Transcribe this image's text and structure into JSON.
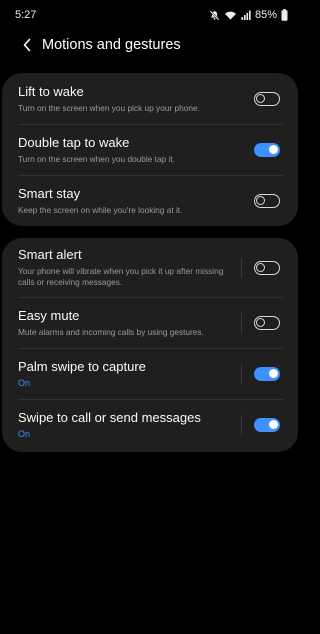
{
  "status_bar": {
    "time": "5:27",
    "battery": "85%"
  },
  "header": {
    "title": "Motions and gestures"
  },
  "group1": [
    {
      "title": "Lift to wake",
      "subtitle": "Turn on the screen when you pick up your phone.",
      "enabled": false
    },
    {
      "title": "Double tap to wake",
      "subtitle": "Turn on the screen when you double tap it.",
      "enabled": true
    },
    {
      "title": "Smart stay",
      "subtitle": "Keep the screen on while you're looking at it.",
      "enabled": false
    }
  ],
  "group2": [
    {
      "title": "Smart alert",
      "subtitle": "Your phone will vibrate when you pick it up after missing calls or receiving messages.",
      "enabled": false
    },
    {
      "title": "Easy mute",
      "subtitle": "Mute alarms and incoming calls by using gestures.",
      "enabled": false
    },
    {
      "title": "Palm swipe to capture",
      "subtitle": "On",
      "enabled": true
    },
    {
      "title": "Swipe to call or send messages",
      "subtitle": "On",
      "enabled": true
    }
  ],
  "colors": {
    "accent": "#3e91ff",
    "card": "#1f1f1f",
    "background": "#000000"
  }
}
